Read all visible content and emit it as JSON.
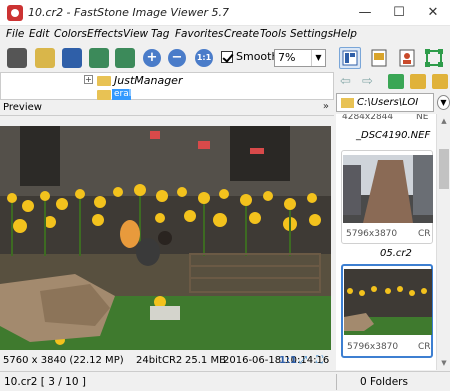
{
  "window": {
    "title": "10.cr2 - FastStone Image Viewer 5.7",
    "minimize": "—",
    "maximize": "☐",
    "close": "✕"
  },
  "menu": {
    "items": [
      "File",
      "Edit",
      "Colors",
      "Effects",
      "View",
      "Tag",
      "Favorites",
      "Create",
      "Tools",
      "Settings",
      "Help"
    ]
  },
  "toolbar": {
    "smooth_label": "Smooth",
    "smooth_checked": true,
    "zoom_value": "7%"
  },
  "tree": {
    "folder_label": "JustManager",
    "selected_label": "eral",
    "expander": "+"
  },
  "path": {
    "value": "C:\\Users\\LOI"
  },
  "preview": {
    "label": "Preview",
    "chevron": "»"
  },
  "image_info": {
    "dimensions": "5760 x 3840 (22.12 MP)",
    "bit_depth": "24bit",
    "format": "CR2",
    "size": "25.1 MB",
    "datetime": "2016-06-18 10:14:16",
    "ratio": "1:1"
  },
  "thumbnails": [
    {
      "meta_size": "4284x2844",
      "meta_type": "NE",
      "name": "_DSC4190.NEF"
    },
    {
      "meta_size": "5796x3870",
      "meta_type": "CR",
      "name": "05.cr2"
    },
    {
      "meta_size": "5796x3870",
      "meta_type": "CR",
      "name": ""
    }
  ],
  "status": {
    "file_position": "10.cr2 [ 3 / 10 ]",
    "folders": "0 Folders"
  },
  "icons": {
    "colors": {
      "accent": "#3d7fd1",
      "folder": "#e8c254",
      "selection": "#3399ff"
    }
  }
}
